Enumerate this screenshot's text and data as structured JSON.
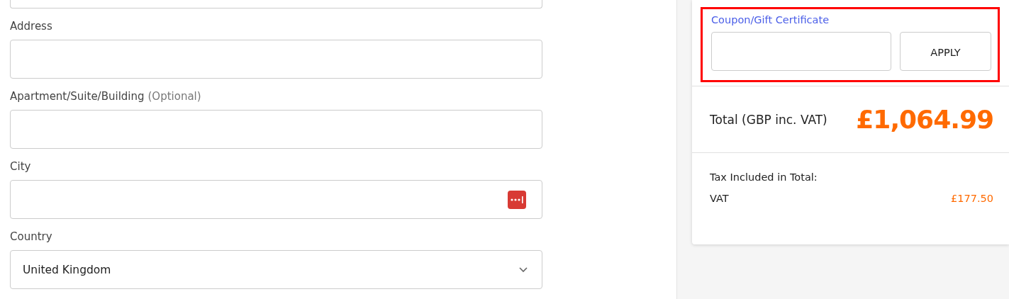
{
  "fields": [
    {
      "kind": "text",
      "label": "Address"
    },
    {
      "kind": "text",
      "label": "Apartment/Suite/Building",
      "hint": "(Optional)"
    },
    {
      "kind": "text",
      "label": "City",
      "autofill_icon": true
    },
    {
      "kind": "select",
      "label": "Country",
      "value": "United Kingdom"
    }
  ],
  "coupon": {
    "label": "Coupon/Gift Certificate",
    "button": "APPLY",
    "highlighted": true
  },
  "total": {
    "label": "Total (GBP inc. VAT)",
    "amount": "£1,064.99"
  },
  "tax": {
    "heading": "Tax Included in Total:",
    "rows": [
      {
        "name": "VAT",
        "amount": "£177.50"
      }
    ]
  }
}
